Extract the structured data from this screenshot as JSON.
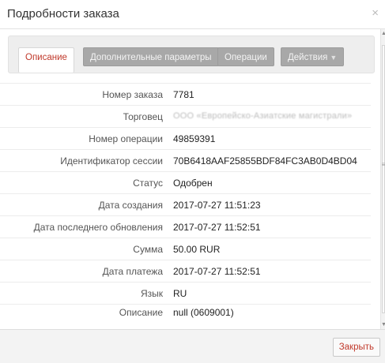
{
  "dialog": {
    "title": "Подробности заказа",
    "close_symbol": "×"
  },
  "tabs": [
    {
      "label": "Описание"
    },
    {
      "label": "Дополнительные параметры"
    },
    {
      "label": "Операции"
    },
    {
      "label": "Действия"
    }
  ],
  "details": {
    "order_number": {
      "label": "Номер заказа",
      "value": "7781"
    },
    "merchant": {
      "label": "Торговец",
      "value": "ООО «Европейско-Азиатские магистрали»"
    },
    "operation_number": {
      "label": "Номер операции",
      "value": "49859391"
    },
    "session_id": {
      "label": "Идентификатор сессии",
      "value": "70B6418AAF25855BDF84FC3AB0D4BD04"
    },
    "status": {
      "label": "Статус",
      "value": "Одобрен"
    },
    "created": {
      "label": "Дата создания",
      "value": "2017-07-27 11:51:23"
    },
    "updated": {
      "label": "Дата последнего обновления",
      "value": "2017-07-27 11:52:51"
    },
    "amount": {
      "label": "Сумма",
      "value": "50.00 RUR"
    },
    "payment_date": {
      "label": "Дата платежа",
      "value": "2017-07-27 11:52:51"
    },
    "language": {
      "label": "Язык",
      "value": "RU"
    },
    "description": {
      "label": "Описание",
      "value": "null (0609001)"
    }
  },
  "footer": {
    "close_label": "Закрыть"
  },
  "icons": {
    "dropdown_caret": "caret-down-icon",
    "scroll_up": "arrow-up-icon",
    "scroll_down": "arrow-down-icon"
  }
}
